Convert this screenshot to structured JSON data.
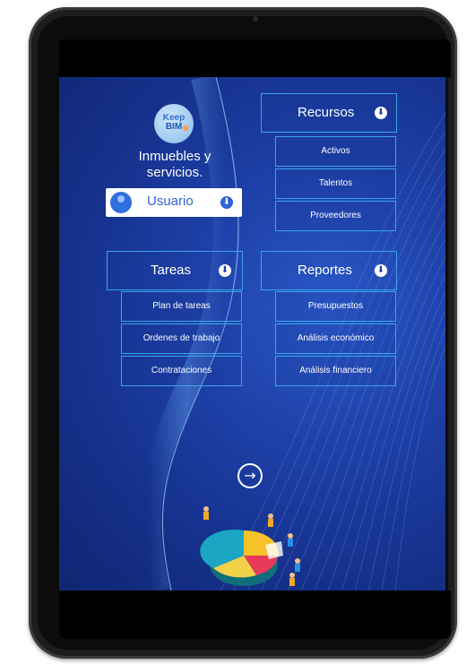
{
  "app": {
    "logo_line1": "Keep",
    "logo_line2": "BIM",
    "title_line1": "Inmuebles y",
    "title_line2": "servicios."
  },
  "user": {
    "label": "Usuario"
  },
  "icons": {
    "dropdown": "⬇",
    "next": "→"
  },
  "menus": {
    "recursos": {
      "label": "Recursos",
      "items": [
        "Activos",
        "Talentos",
        "Proveedores"
      ]
    },
    "tareas": {
      "label": "Tareas",
      "items": [
        "Plan de tareas",
        "Ordenes de trabajo",
        "Contrataciones"
      ]
    },
    "reportes": {
      "label": "Reportes",
      "items": [
        "Presupuestos",
        "Análisis económico",
        "Análisis financiero"
      ]
    }
  },
  "colors": {
    "accent_border": "#3aa5e8",
    "screen_bg": "#1e40a8",
    "user_text": "#2d62d8"
  }
}
